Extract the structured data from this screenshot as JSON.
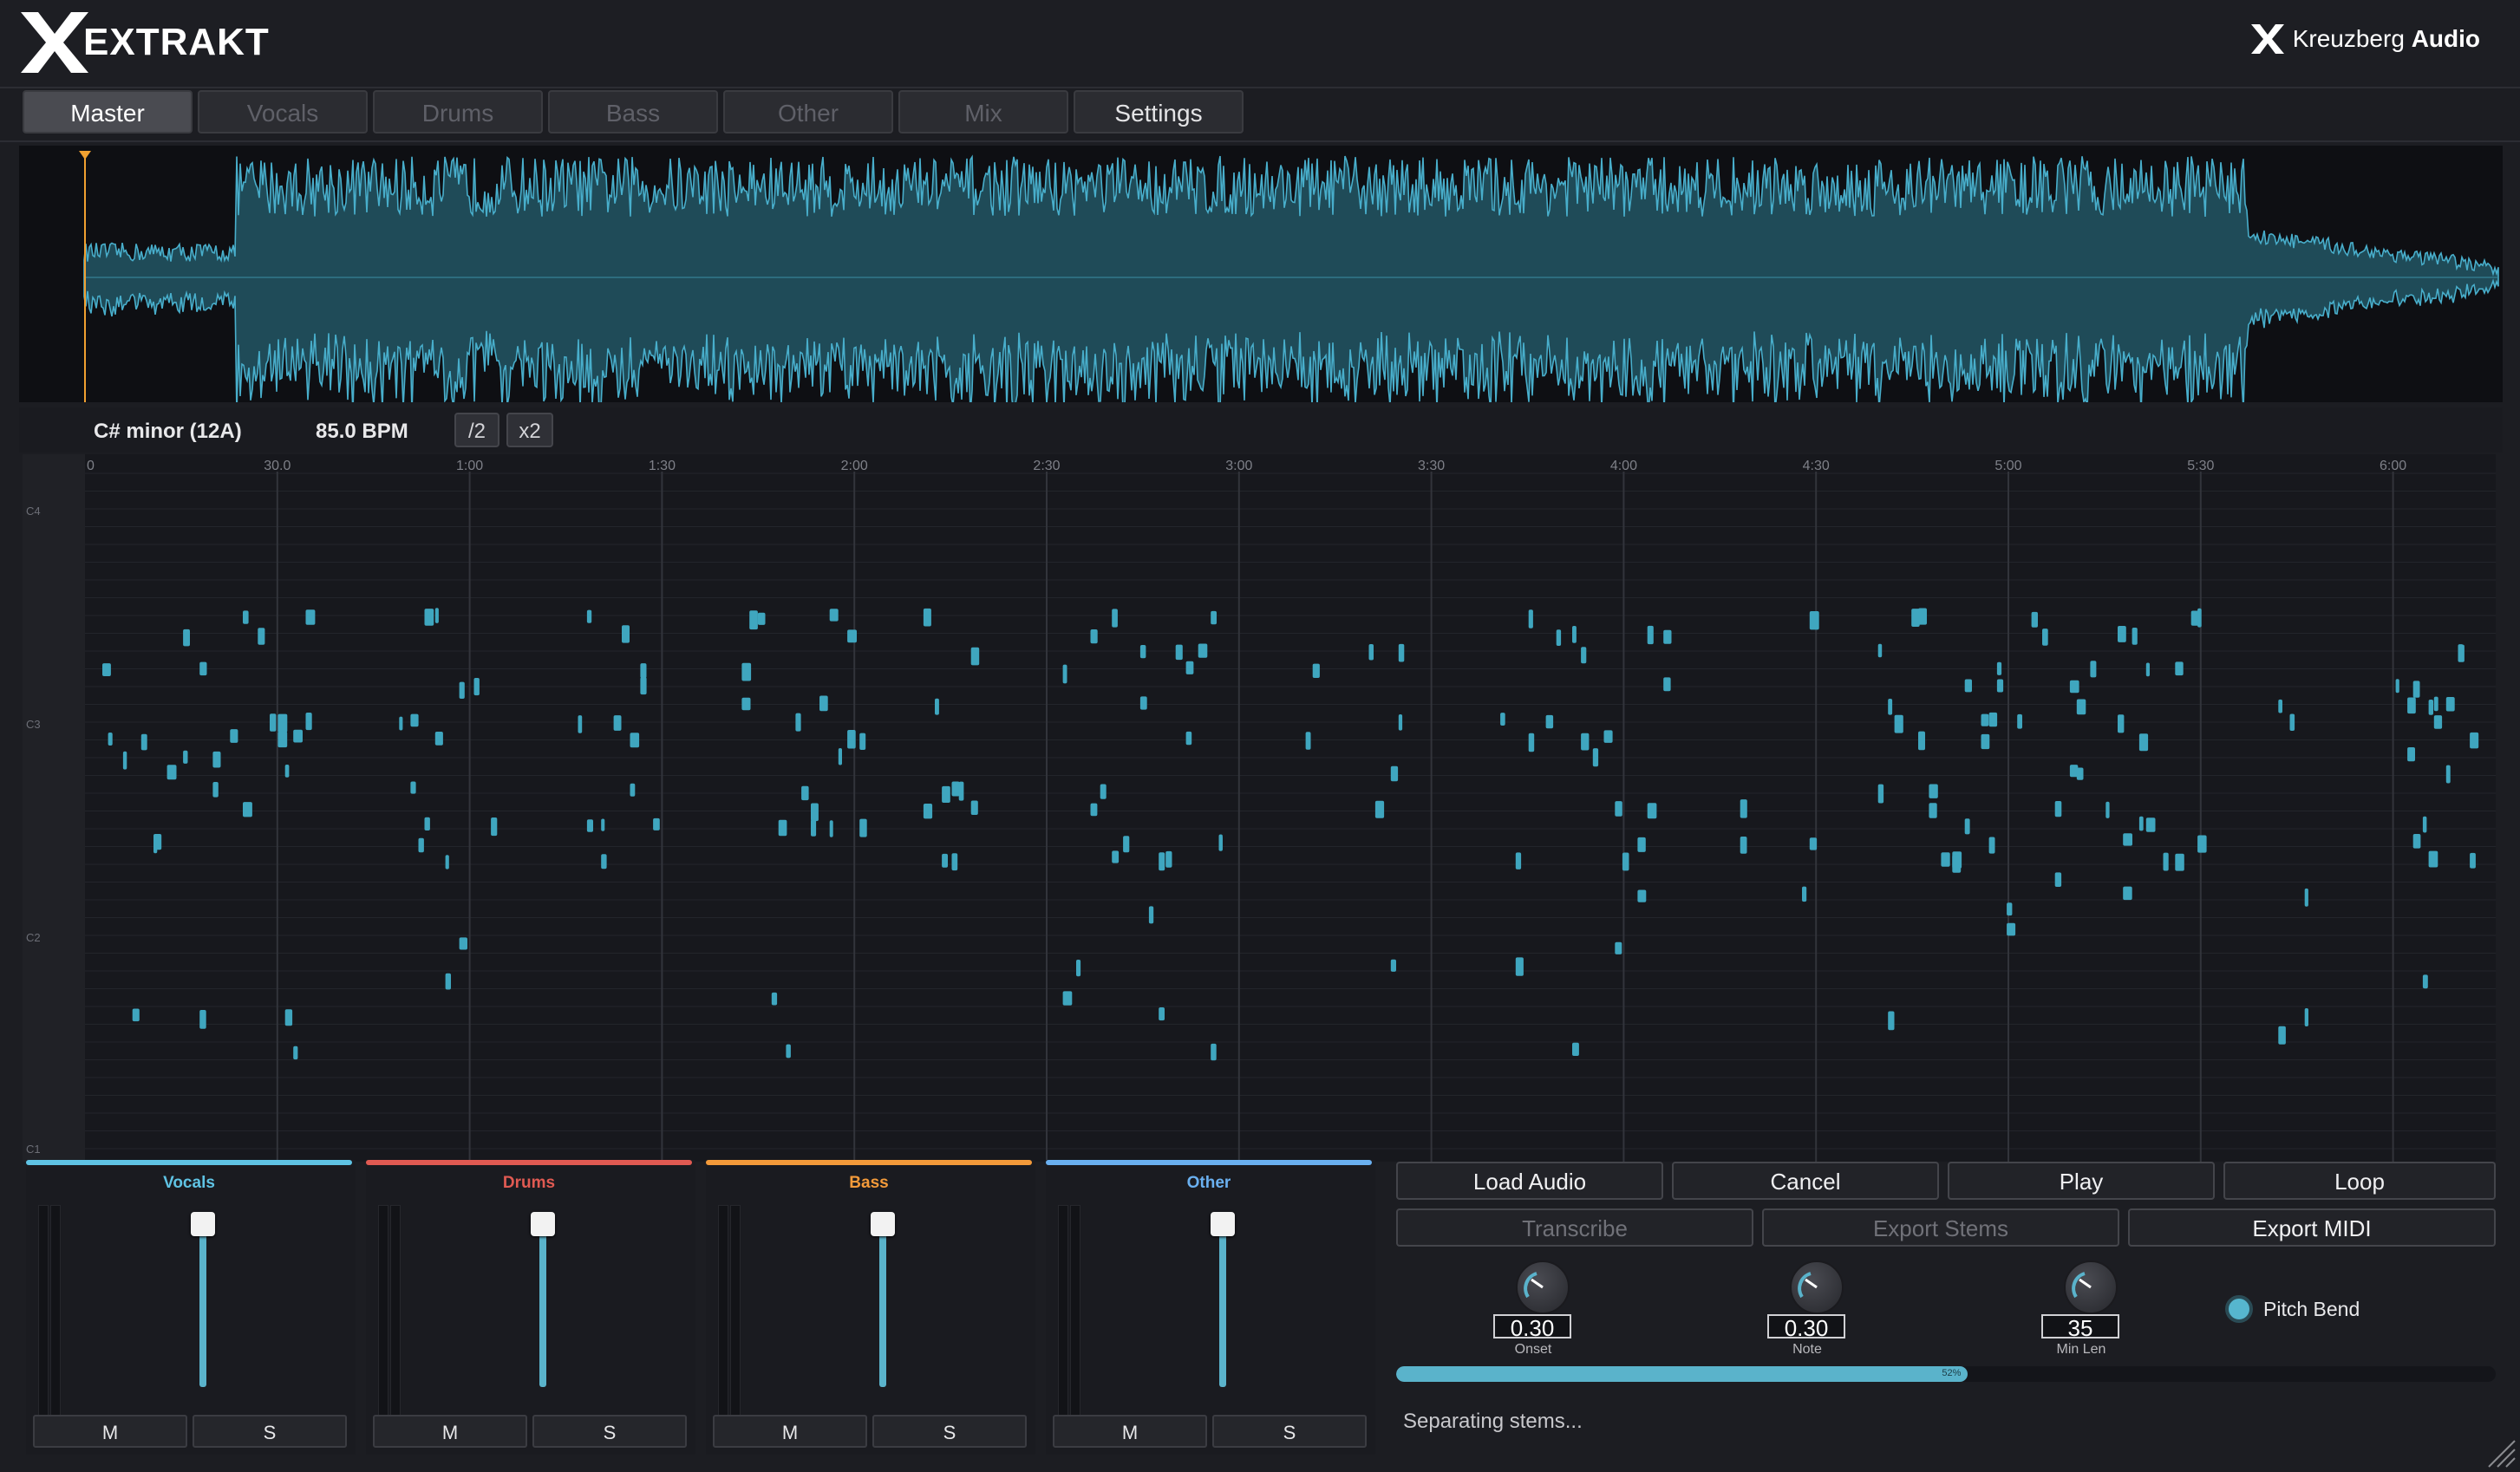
{
  "app": {
    "logo_text": "EXTRAKT",
    "brand_light": "Kreuzberg",
    "brand_bold": "Audio"
  },
  "tabs": [
    {
      "label": "Master",
      "state": "active"
    },
    {
      "label": "Vocals",
      "state": "disabled"
    },
    {
      "label": "Drums",
      "state": "disabled"
    },
    {
      "label": "Bass",
      "state": "disabled"
    },
    {
      "label": "Other",
      "state": "disabled"
    },
    {
      "label": "Mix",
      "state": "disabled"
    },
    {
      "label": "Settings",
      "state": "enabled"
    }
  ],
  "info": {
    "key": "C# minor (12A)",
    "bpm": "85.0 BPM",
    "half_label": "/2",
    "double_label": "x2"
  },
  "timeline": {
    "ticks": [
      "0",
      "30.0",
      "1:00",
      "1:30",
      "2:00",
      "2:30",
      "3:00",
      "3:30",
      "4:00",
      "4:30",
      "5:00",
      "5:30",
      "6:00"
    ],
    "octave_labels": [
      "C4",
      "C3",
      "C2",
      "C1"
    ],
    "duration_seconds": 380
  },
  "mixer": [
    {
      "name": "Vocals",
      "color": "#5fc3e4",
      "mute": "M",
      "solo": "S"
    },
    {
      "name": "Drums",
      "color": "#e05a52",
      "mute": "M",
      "solo": "S"
    },
    {
      "name": "Bass",
      "color": "#f39a3a",
      "mute": "M",
      "solo": "S"
    },
    {
      "name": "Other",
      "color": "#6ab0f0",
      "mute": "M",
      "solo": "S"
    }
  ],
  "buttons": {
    "load_audio": "Load Audio",
    "cancel": "Cancel",
    "play": "Play",
    "loop": "Loop",
    "transcribe": "Transcribe",
    "export_stems": "Export Stems",
    "export_midi": "Export MIDI"
  },
  "knobs": [
    {
      "label": "Onset",
      "value": "0.30"
    },
    {
      "label": "Note",
      "value": "0.30"
    },
    {
      "label": "Min Len",
      "value": "35"
    }
  ],
  "pitch_bend": {
    "label": "Pitch Bend",
    "checked": true
  },
  "progress": {
    "fraction": 0.52,
    "label": "52%"
  },
  "status": "Separating stems...",
  "colors": {
    "accent": "#5ab3cb",
    "playhead": "#f0a030",
    "note": "#3fa6bf"
  }
}
